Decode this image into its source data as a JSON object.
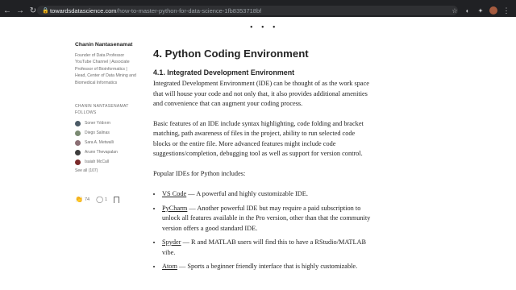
{
  "browser": {
    "url_domain": "towardsdatascience.com",
    "url_path": "/how-to-master-python-for-data-science-1fb8353718bf",
    "icons": [
      "back-icon",
      "forward-icon",
      "reload-icon",
      "lock-icon",
      "star-icon",
      "extension-icon",
      "puzzle-icon",
      "profile-avatar",
      "menu-icon"
    ]
  },
  "page": {
    "separator": "• • •"
  },
  "sidebar": {
    "author_name": "Chanin Nantasenamat",
    "author_bio": "Founder of Data Professor YouTube Channel | Associate Professor of Bioinformatics | Head, Center of Data Mining and Biomedical Informatics",
    "follows_heading": "CHANIN NANTASENAMAT FOLLOWS",
    "follows": [
      {
        "name": "Soner Yıldırım",
        "color": "#4b5a66"
      },
      {
        "name": "Diego Salinas",
        "color": "#7a8a72"
      },
      {
        "name": "Sara A. Metwalli",
        "color": "#8a6e73"
      },
      {
        "name": "Arunn Thevapalan",
        "color": "#3d3d3d"
      },
      {
        "name": "Isaiah McCall",
        "color": "#7a2a2a"
      }
    ],
    "see_all": "See all (107)",
    "claps": "74",
    "responses": "1"
  },
  "article": {
    "heading": "4. Python Coding Environment",
    "subheading": "4.1. Integrated Development Environment",
    "para1": "Integrated Development Environment (IDE) can be thought of as the work space that will house your code and not only that, it also provides additional amenities and convenience that can augment your coding process.",
    "para2": "Basic features of an IDE include syntax highlighting, code folding and bracket matching, path awareness of files in the project, ability to run selected code blocks or the entire file. More advanced features might include code suggestions/completion, debugging tool as well as support for version control.",
    "para3": "Popular IDEs for Python includes:",
    "ides": [
      {
        "name": "VS Code",
        "desc": " — A powerful and highly customizable IDE."
      },
      {
        "name": "PyCharm",
        "desc": " — Another powerful IDE but may require a paid subscription to unlock all features available in the Pro version, other than that the community version offers a good standard IDE."
      },
      {
        "name": "Spyder",
        "desc": " — R and MATLAB users will find this to have a RStudio/MATLAB vibe."
      },
      {
        "name": "Atom",
        "desc": " — Sports a beginner friendly interface that is highly customizable."
      }
    ]
  }
}
